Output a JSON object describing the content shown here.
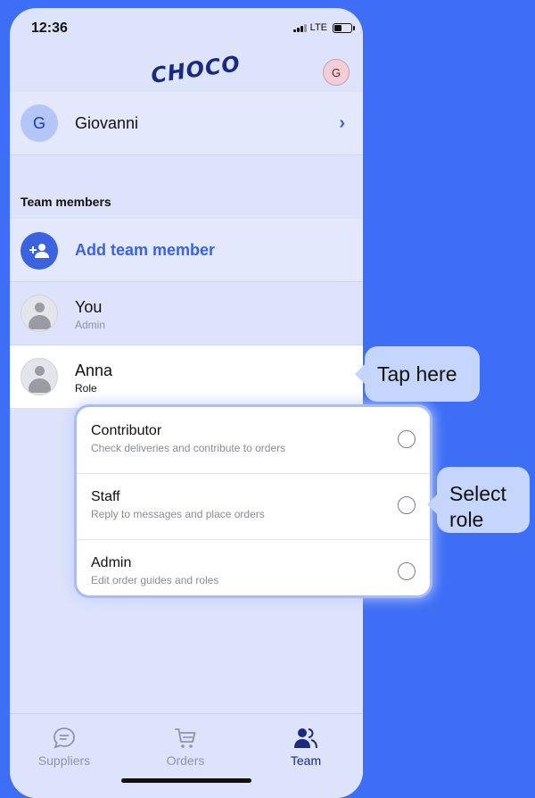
{
  "status_bar": {
    "time": "12:36",
    "network": "LTE"
  },
  "header": {
    "logo_text": "CHOCO",
    "avatar_initial": "G"
  },
  "current_user": {
    "initial": "G",
    "name": "Giovanni"
  },
  "team_section": {
    "title": "Team members",
    "add_label": "Add team member"
  },
  "members": [
    {
      "name": "You",
      "role": "Admin"
    },
    {
      "name": "Anna",
      "role": "Role"
    }
  ],
  "role_options": [
    {
      "title": "Contributor",
      "description": "Check deliveries and contribute to orders"
    },
    {
      "title": "Staff",
      "description": "Reply to messages and place orders"
    },
    {
      "title": "Admin",
      "description": "Edit order guides and roles"
    }
  ],
  "callouts": {
    "tap": "Tap here",
    "select_line1": "Select",
    "select_line2": "role"
  },
  "tabs": [
    {
      "label": "Suppliers",
      "icon": "chat-bubble-icon"
    },
    {
      "label": "Orders",
      "icon": "cart-icon"
    },
    {
      "label": "Team",
      "icon": "team-icon",
      "active": true
    }
  ],
  "colors": {
    "background": "#3d6ef5",
    "accent": "#3b63e0",
    "brand": "#1a2a80",
    "callout": "#c5d5fb"
  }
}
